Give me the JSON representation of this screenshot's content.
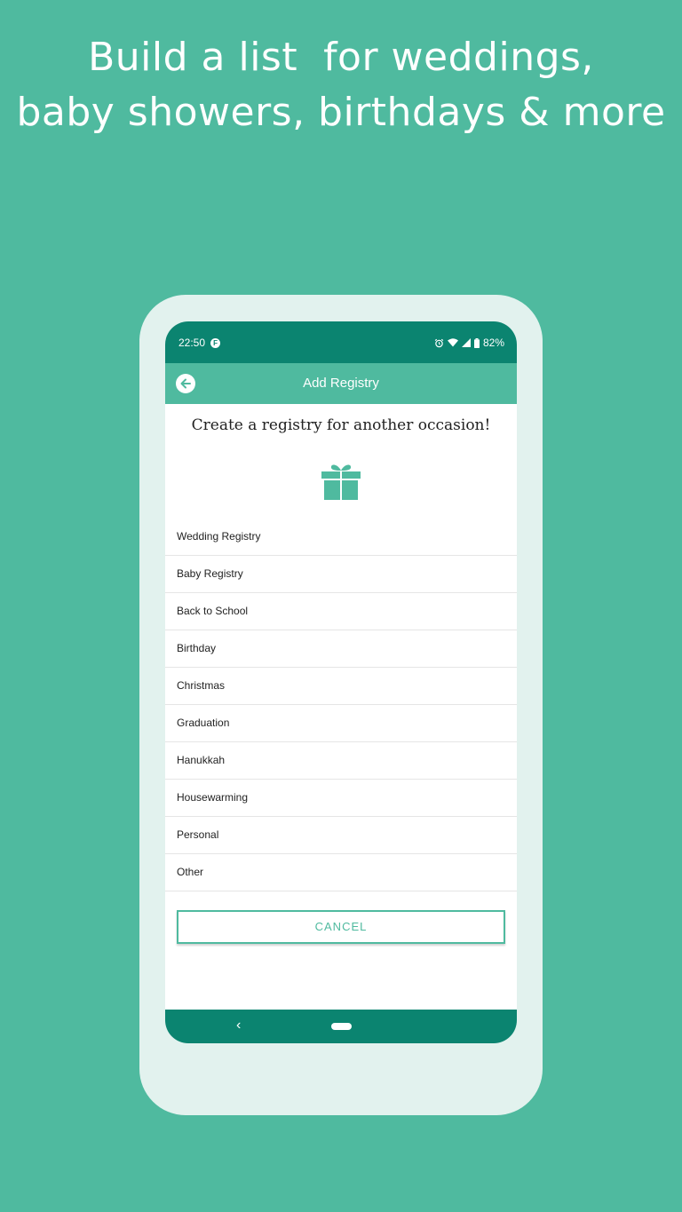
{
  "headline": {
    "line1": "Build a list  for weddings,",
    "line2": "baby showers, birthdays & more"
  },
  "status_bar": {
    "time": "22:50",
    "app_badge": "F",
    "battery": "82%",
    "icons": [
      "alarm-icon",
      "wifi-icon",
      "signal-icon",
      "battery-icon"
    ]
  },
  "toolbar": {
    "title": "Add Registry",
    "back_icon": "back-arrow-icon"
  },
  "content": {
    "title": "Create a registry for another occasion!",
    "icon": "gift-icon"
  },
  "registry_types": [
    "Wedding Registry",
    "Baby Registry",
    "Back to School",
    "Birthday",
    "Christmas",
    "Graduation",
    "Hanukkah",
    "Housewarming",
    "Personal",
    "Other"
  ],
  "cancel_label": "CANCEL",
  "nav": {
    "back_glyph": "‹"
  },
  "colors": {
    "background": "#4fba9f",
    "status_bar": "#0b8470",
    "accent": "#4fba9f",
    "frame": "#e2f2ee"
  }
}
